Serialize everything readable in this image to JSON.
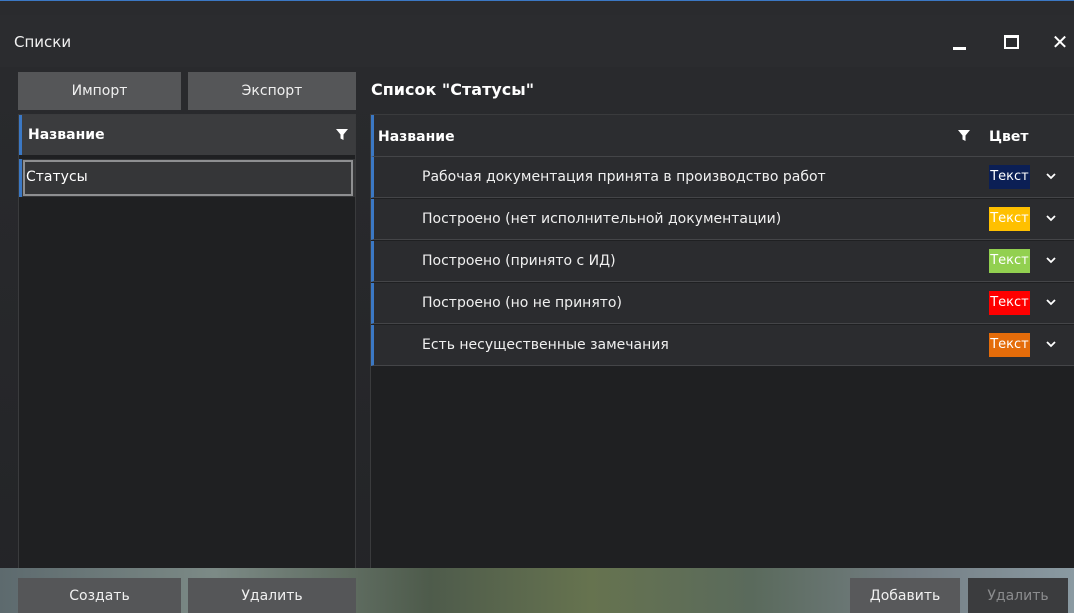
{
  "window": {
    "title": "Списки"
  },
  "left": {
    "import_label": "Импорт",
    "export_label": "Экспорт",
    "header": "Название",
    "items": [
      {
        "label": "Статусы"
      }
    ],
    "create_label": "Создать",
    "delete_label": "Удалить"
  },
  "right": {
    "title": "Список \"Статусы\"",
    "col_name": "Название",
    "col_color": "Цвет",
    "rows": [
      {
        "label": "Рабочая документация принята в производство работ",
        "swatch_text": "Текст",
        "bg": "#0b1f55",
        "fg": "#ffffff"
      },
      {
        "label": "Построено (нет исполнительной документации)",
        "swatch_text": "Текст",
        "bg": "#ffc000",
        "fg": "#ffffff"
      },
      {
        "label": "Построено (принято с ИД)",
        "swatch_text": "Текст",
        "bg": "#92d050",
        "fg": "#ffffff"
      },
      {
        "label": "Построено (но не принято)",
        "swatch_text": "Текст",
        "bg": "#ff0000",
        "fg": "#ffffff"
      },
      {
        "label": "Есть несущественные замечания",
        "swatch_text": "Текст",
        "bg": "#e46c0a",
        "fg": "#ffffff"
      }
    ],
    "add_label": "Добавить",
    "delete_label": "Удалить"
  },
  "colors": {
    "accent": "#3b78c4",
    "button": "#555658",
    "background": "#1f2022"
  }
}
